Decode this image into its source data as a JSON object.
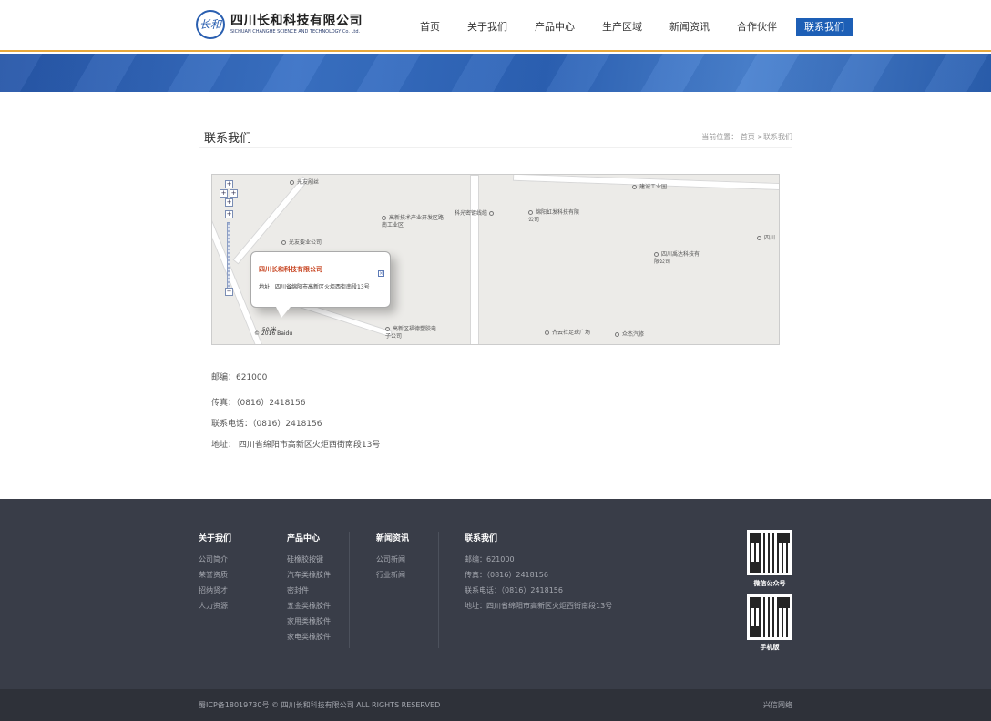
{
  "logo": {
    "mark": "长和",
    "name_cn": "四川长和科技有限公司",
    "name_en": "SICHUAN CHANGHE SCIENCE AND TECHNOLOGY Co. Ltd."
  },
  "nav": [
    {
      "label": "首页"
    },
    {
      "label": "关于我们"
    },
    {
      "label": "产品中心"
    },
    {
      "label": "生产区域"
    },
    {
      "label": "新闻资讯"
    },
    {
      "label": "合作伙伴"
    },
    {
      "label": "联系我们"
    }
  ],
  "page": {
    "title": "联系我们",
    "breadcrumb_prefix": "当前位置：",
    "breadcrumb_home": "首页",
    "breadcrumb_current": ">联系我们"
  },
  "map": {
    "pois": [
      "光友剐丝",
      "高新技术产业开发区路南工业区",
      "科光密镀线缆",
      "绵阳虹发科技有限公司",
      "建诚工业园",
      "光友要业公司",
      "四川禹达科技有限公司",
      "四川",
      "高新区福德塑胶电子公司",
      "齐云社足球广场",
      "众杰汽修"
    ],
    "popup_title": "四川长和科技有限公司",
    "popup_address": "地址：四川省绵阳市高新区火炬西街南段13号",
    "scale": "50 米",
    "copyright": "© 2016 Baidu"
  },
  "contact": {
    "postcode": "邮编：621000",
    "fax": "传真：（0816）2418156",
    "phone": "联系电话：（0816）2418156",
    "address": "地址： 四川省绵阳市高新区火炬西街南段13号"
  },
  "footer": {
    "about": {
      "title": "关于我们",
      "links": [
        "公司简介",
        "荣誉资质",
        "招纳贤才",
        "人力资源"
      ]
    },
    "products": {
      "title": "产品中心",
      "links": [
        "硅橡胶按键",
        "汽车类橡胶件",
        "密封件",
        "五金类橡胶件",
        "家用类橡胶件",
        "家电类橡胶件"
      ]
    },
    "news": {
      "title": "新闻资讯",
      "links": [
        "公司新闻",
        "行业新闻"
      ]
    },
    "contact": {
      "title": "联系我们",
      "lines": [
        "邮编：621000",
        "传真：（0816）2418156",
        "联系电话：（0816）2418156",
        "地址：四川省绵阳市高新区火炬西街南段13号"
      ]
    },
    "qr1_label": "微信公众号",
    "qr2_label": "手机版",
    "copyright": "蜀ICP备18019730号 © 四川长和科技有限公司 ALL RIGHTS RESERVED",
    "maker": "兴信网络"
  },
  "colors": {
    "accent": "#1d5fb6",
    "header_border": "#e7a83c",
    "footer_bg": "#393d48"
  }
}
